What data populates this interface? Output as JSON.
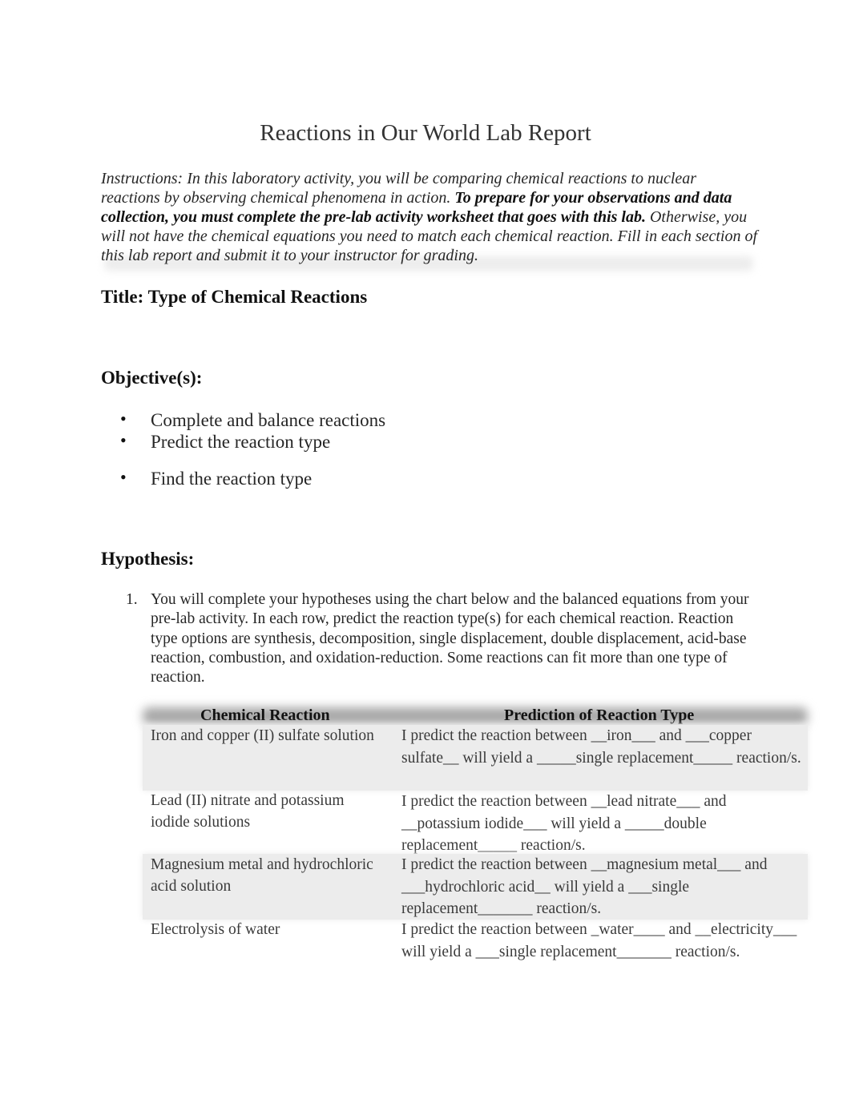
{
  "document": {
    "title": "Reactions in Our World Lab Report",
    "instructions": {
      "italic_lead": "Instructions: In this laboratory activity, you will be comparing chemical reactions to nuclear reactions by observing chemical phenomena in action. ",
      "bold": "To prepare for your observations and data collection, you must complete the pre-lab activity worksheet that goes with this lab.",
      "italic_tail": " Otherwise, you will not have the chemical equations you need to match each chemical reaction. Fill in each section of this lab report and submit it to your instructor for grading."
    },
    "title_section": "Title: Type of Chemical Reactions",
    "objectives": {
      "heading": "Objective(s):",
      "items": [
        "Complete and balance reactions",
        "Predict the reaction type",
        "Find the reaction type"
      ],
      "bullet": "•"
    },
    "hypothesis": {
      "heading": "Hypothesis:",
      "list_number": "1.",
      "text": "You will complete your hypotheses using the chart below and the balanced equations from your pre-lab activity. In each row, predict the reaction type(s) for each chemical reaction. Reaction type options are synthesis, decomposition, single displacement, double displacement, acid-base reaction, combustion, and oxidation-reduction. Some reactions can fit more than one type of reaction."
    },
    "table": {
      "headers": [
        "Chemical Reaction",
        "Prediction of Reaction Type"
      ],
      "rows": [
        {
          "reaction": "Iron and copper (II) sulfate solution",
          "prediction": "I predict the reaction between __iron___ and ___copper sulfate__ will yield a _____single replacement_____ reaction/s."
        },
        {
          "reaction": "Lead (II) nitrate and potassium iodide solutions",
          "prediction": "I predict the reaction between __lead nitrate___ and __potassium iodide___ will yield a _____double replacement_____ reaction/s."
        },
        {
          "reaction": "Magnesium metal and hydrochloric acid solution",
          "prediction": "I predict the reaction between __magnesium metal___ and ___hydrochloric acid__ will yield a ___single replacement_______ reaction/s."
        },
        {
          "reaction": "Electrolysis of water",
          "prediction": "I predict the reaction between _water____ and __electricity___ will yield a ___single replacement_______ reaction/s."
        }
      ]
    }
  }
}
